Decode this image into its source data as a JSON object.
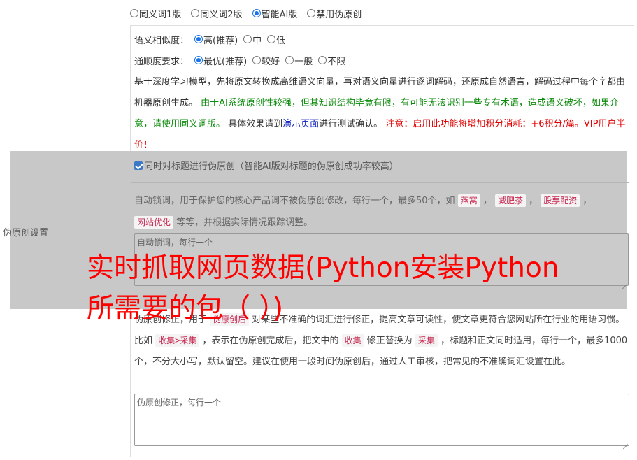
{
  "modes": {
    "options": [
      "同义词1版",
      "同义词2版",
      "智能AI版",
      "禁用伪原创"
    ],
    "selected": "智能AI版"
  },
  "similarity": {
    "label": "语义相似度：",
    "options": [
      "高(推荐)",
      "中",
      "低"
    ],
    "selected": "高(推荐)"
  },
  "fluency": {
    "label": "通顺度要求：",
    "options": [
      "最优(推荐)",
      "较好",
      "一般",
      "不限"
    ],
    "selected": "最优(推荐)"
  },
  "description": {
    "part1": "基于深度学习模型，先将原文转换成高维语义向量，再对语义向量进行逐词解码，还原成自然语言，解码过程中每个字都由机器原创生成。 ",
    "part2": "由于AI系统原创性较强，但其知识结构毕竟有限，有可能无法识别一些专有术语，造成语义破坏，如果介意，请使用同义词版。",
    "part3": " 具体效果请到",
    "link": "演示页面",
    "part4": "进行测试确认。 ",
    "part5": "注意：启用此功能将增加积分消耗：+6积分/篇。VIP用户半价！"
  },
  "section_label": "伪原创设置",
  "title_option": {
    "label": "同时对标题进行伪原创（智能AI版对标题的伪原创成功率较高）",
    "checked": true
  },
  "lock_words": {
    "desc_before": "自动锁词，用于保护您的核心产品词不被伪原创修改，每行一个，最多50个，如 ",
    "examples": [
      "燕窝",
      "减肥茶",
      "股票配资",
      "网站优化"
    ],
    "desc_after": " 等等，并根据实际情况跟踪调整。",
    "placeholder": "自动锁词，每行一个"
  },
  "corrections": {
    "desc1": "伪原创修正，用于 ",
    "chip1": "伪原创后",
    "desc2": " 对某些不准确的词汇进行修正，提高文章可读性，使文章更符合您网站所在行业的用语习惯。比如 ",
    "chip2": "收集>采集",
    "desc3": " ，表示在伪原创完成后，把文中的 ",
    "chip3": "收集",
    "desc4": " 修正替换为 ",
    "chip4": "采集",
    "desc5": " ，标题和正文同时适用，每行一个，最多1000个，不分大小写，默认留空。建议在使用一段时间伪原创后，通过人工审核，把常见的不准确词汇设置在此。",
    "placeholder": "伪原创修正，每行一个"
  },
  "headline": "实时抓取网页数据(Python安装Python所需要的包（ ）)"
}
